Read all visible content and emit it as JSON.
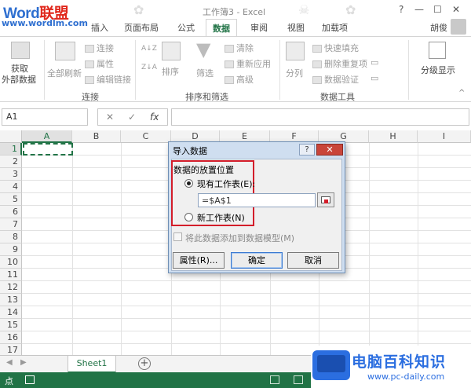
{
  "watermark": {
    "logo_word": "Word",
    "logo_cn": "联盟",
    "url": "www.wordlm.com"
  },
  "window": {
    "title": "工作簿3 - Excel",
    "help": "?",
    "min": "—",
    "max": "☐",
    "close": "✕"
  },
  "tabs": [
    {
      "label": "插入"
    },
    {
      "label": "页面布局"
    },
    {
      "label": "公式"
    },
    {
      "label": "数据"
    },
    {
      "label": "审阅"
    },
    {
      "label": "视图"
    },
    {
      "label": "加载项"
    }
  ],
  "user": {
    "name": "胡俊"
  },
  "ribbon": {
    "get_data_line1": "获取",
    "get_data_line2": "外部数据",
    "refresh_all": "全部刷新",
    "connections": "连接",
    "properties": "属性",
    "edit_links": "编辑链接",
    "group_connections": "连接",
    "sort_az": "A↓Z",
    "sort_za": "Z↓A",
    "sort": "排序",
    "filter": "筛选",
    "clear": "清除",
    "reapply": "重新应用",
    "advanced": "高级",
    "group_sort_filter": "排序和筛选",
    "text_to_columns": "分列",
    "flash_fill": "快速填充",
    "remove_duplicates": "删除重复项",
    "data_validation": "数据验证",
    "group_data_tools": "数据工具",
    "outline": "分级显示"
  },
  "formula_bar": {
    "name_box": "A1",
    "cancel": "✕",
    "enter": "✓",
    "fx": "fx",
    "value": ""
  },
  "columns": [
    "A",
    "B",
    "C",
    "D",
    "E",
    "F",
    "G",
    "H",
    "I"
  ],
  "rows": [
    "1",
    "2",
    "3",
    "4",
    "5",
    "6",
    "7",
    "8",
    "9",
    "10",
    "11",
    "12",
    "13",
    "14",
    "15",
    "16",
    "17"
  ],
  "sheets": [
    {
      "label": "Sheet1"
    }
  ],
  "add_sheet": "+",
  "status": {
    "ready": "点"
  },
  "dialog": {
    "title": "导入数据",
    "help": "?",
    "close": "✕",
    "section_label": "数据的放置位置",
    "option_existing": "现有工作表(E):",
    "option_new": "新工作表(N)",
    "reference": "=$A$1",
    "add_to_model": "将此数据添加到数据模型(M)",
    "properties_button": "属性(R)...",
    "ok_button": "确定",
    "cancel_button": "取消",
    "selected_option": "existing"
  },
  "badge": {
    "title": "电脑百科知识",
    "url": "www.pc-daily.com"
  }
}
